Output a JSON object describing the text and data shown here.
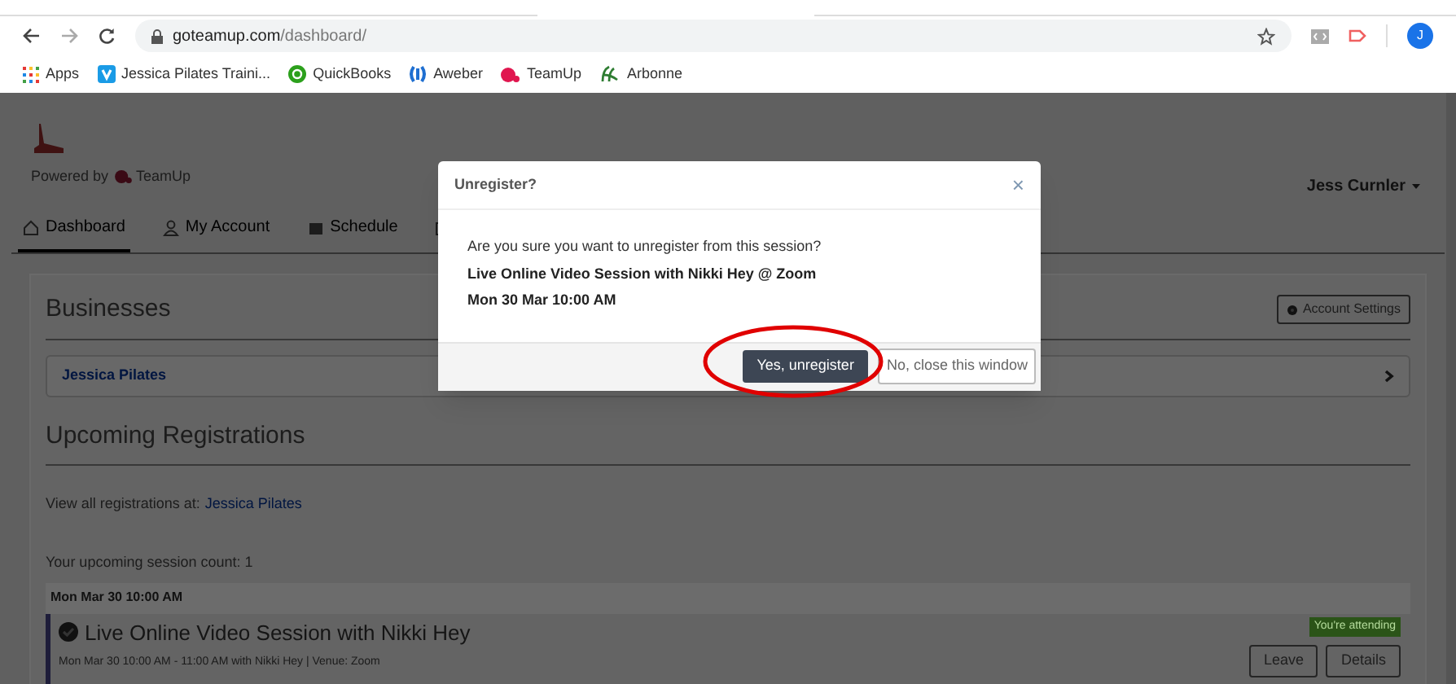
{
  "browser": {
    "url_host": "goteamup.com",
    "url_path": "/dashboard/",
    "profile_initial": "J",
    "bookmarks": [
      "Apps",
      "Jessica Pilates Traini...",
      "QuickBooks",
      "Aweber",
      "TeamUp",
      "Arbonne"
    ]
  },
  "header": {
    "powered_by": "Powered by",
    "brand": "TeamUp",
    "user": "Jess Curnler"
  },
  "nav": [
    {
      "label": "Dashboard",
      "selected": true
    },
    {
      "label": "My Account",
      "selected": false
    },
    {
      "label": "Schedule",
      "selected": false
    },
    {
      "selected": false
    }
  ],
  "businesses": {
    "title": "Businesses",
    "settings_button": "Account Settings",
    "items": [
      "Jessica Pilates"
    ]
  },
  "registrations": {
    "title": "Upcoming Registrations",
    "view_all": "View all registrations at:",
    "view_all_link": "Jessica Pilates",
    "count": "Your upcoming session count: 1",
    "date_header": "Mon Mar 30 10:00 AM",
    "sessions": [
      {
        "title": "Live Online Video Session with Nikki Hey",
        "details": "Mon Mar 30 10:00 AM - 11:00 AM with Nikki Hey | Venue: Zoom",
        "badge": "You're attending",
        "buttons": [
          "Leave",
          "Details"
        ]
      }
    ]
  },
  "dialog": {
    "title": "Unregister?",
    "close": "×",
    "message": "Are you sure you want to unregister from this session?",
    "session": "Live Online Video Session with Nikki Hey @ Zoom",
    "time": "Mon 30 Mar 10:00 AM",
    "confirm": "Yes, unregister",
    "cancel": "No, close this window"
  }
}
